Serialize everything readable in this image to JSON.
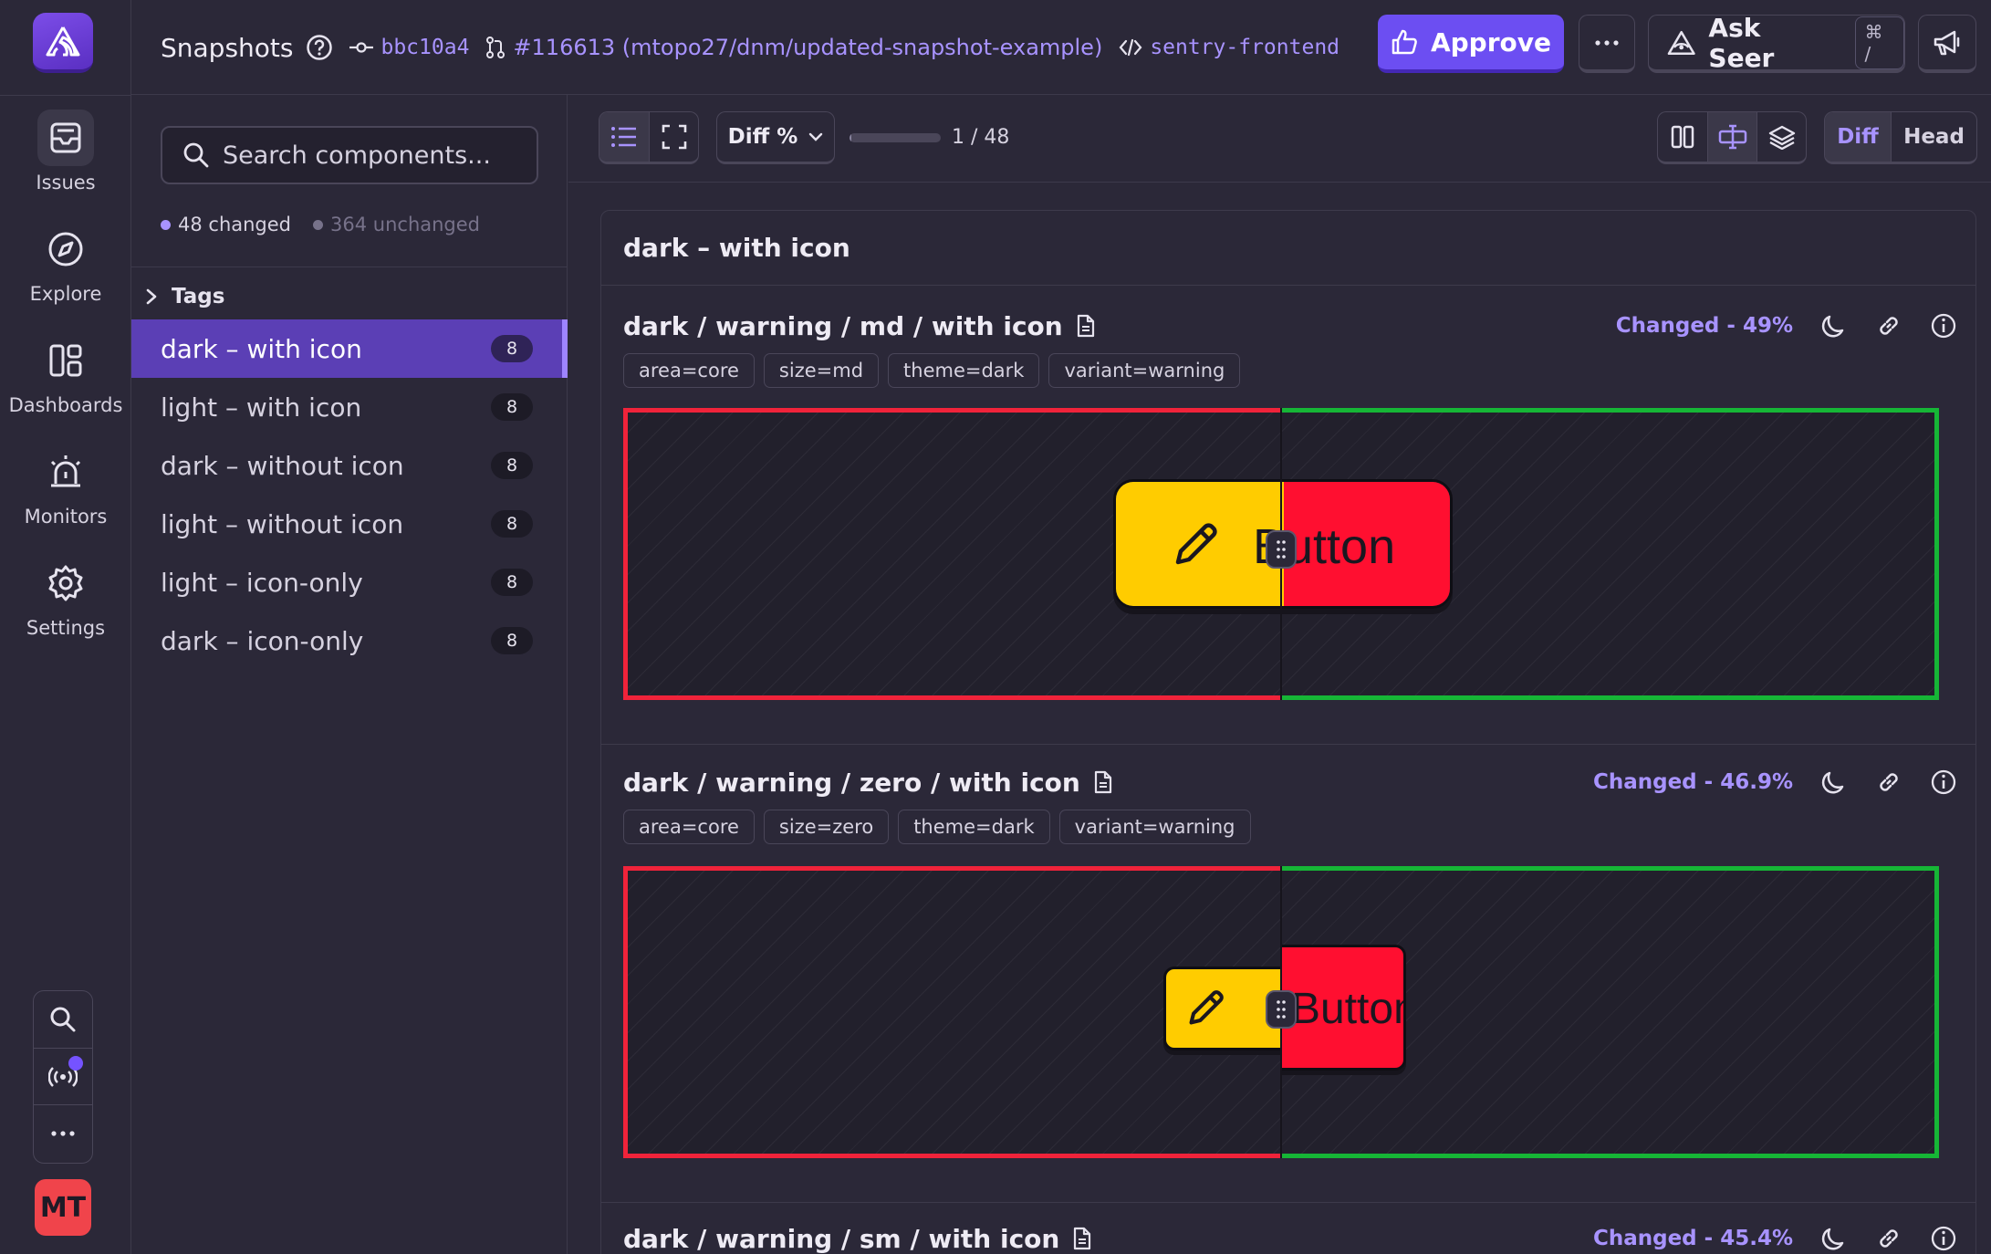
{
  "nav": {
    "items": [
      {
        "label": "Issues",
        "icon": "inbox-icon"
      },
      {
        "label": "Explore",
        "icon": "compass-icon"
      },
      {
        "label": "Dashboards",
        "icon": "dashboard-icon"
      },
      {
        "label": "Monitors",
        "icon": "siren-icon"
      },
      {
        "label": "Settings",
        "icon": "gear-icon"
      }
    ],
    "avatar_initials": "MT"
  },
  "header": {
    "title": "Snapshots",
    "commit": "bbc10a4",
    "pull_request": "#116613 (mtopo27/dnm/updated-snapshot-example)",
    "project": "sentry-frontend",
    "approve_label": "Approve",
    "ask_seer_label": "Ask Seer",
    "ask_seer_shortcut": "⌘ /"
  },
  "sidebar": {
    "search_placeholder": "Search components...",
    "changed_count": "48 changed",
    "unchanged_count": "364 unchanged",
    "tags_label": "Tags",
    "groups": [
      {
        "label": "dark – with icon",
        "count": "8",
        "active": true
      },
      {
        "label": "light – with icon",
        "count": "8"
      },
      {
        "label": "dark – without icon",
        "count": "8"
      },
      {
        "label": "light – without icon",
        "count": "8"
      },
      {
        "label": "light – icon-only",
        "count": "8"
      },
      {
        "label": "dark – icon-only",
        "count": "8"
      }
    ]
  },
  "toolbar": {
    "sort_label": "Diff %",
    "pager": "1 / 48",
    "progress_fraction": 0.0208,
    "diff_label": "Diff",
    "head_label": "Head"
  },
  "content": {
    "group_title": "dark – with icon",
    "snapshots": [
      {
        "title": "dark / warning / md / with icon",
        "status": "Changed - 49%",
        "chips": [
          "area=core",
          "size=md",
          "theme=dark",
          "variant=warning"
        ],
        "button_text": "Button"
      },
      {
        "title": "dark / warning / zero / with icon",
        "status": "Changed - 46.9%",
        "chips": [
          "area=core",
          "size=zero",
          "theme=dark",
          "variant=warning"
        ],
        "button_text": "Button"
      },
      {
        "title": "dark / warning / sm / with icon",
        "status": "Changed - 45.4%",
        "chips": [],
        "button_text": ""
      }
    ]
  },
  "colors": {
    "accent": "#6c4ef2",
    "removed_border": "#f0233a",
    "added_border": "#16b636",
    "base_yellow": "#ffcc00",
    "head_red": "#ff0f30"
  }
}
